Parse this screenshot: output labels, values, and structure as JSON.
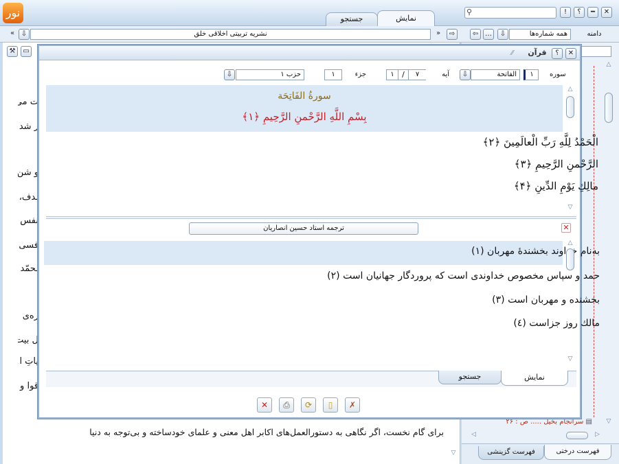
{
  "topbar": {
    "tabs": [
      {
        "label": "نمایش"
      },
      {
        "label": "جستجو"
      }
    ],
    "search_placeholder": "",
    "window_btns": {
      "close": "✕",
      "minimize": "━",
      "help": "؟",
      "alert": "!"
    }
  },
  "address": {
    "domain_label": "دامنه",
    "domain_value": "همه شماره‌ها",
    "publication": "نشریه تربیتی اخلاقی خلق"
  },
  "background_text": {
    "fragments": [
      "ت می",
      "ر شد",
      "و شن",
      "ـدف،",
      "نفس",
      "فسی",
      "ـحمّد",
      "ره‌ی",
      "ل بیت",
      "یاتِ ا",
      "قوا و"
    ],
    "bottom_line": "برای گام نخست، اگر نگاهی به دستورالعمل‌های اکابر اهل معنی و علمای خودساخته و بی‌توجه به دنیا"
  },
  "right_panel": {
    "tree_item": "سرانجام بخیل ..... ص : ۲۶",
    "tabs": [
      {
        "label": "فهرست درختی"
      },
      {
        "label": "فهرست گزینشی"
      }
    ]
  },
  "dialog": {
    "title": "قرآن",
    "help": "؟",
    "close": "✕",
    "labels": {
      "surah": "سوره",
      "ayah": "آیه",
      "juz": "جزء",
      "hizb": "حزب"
    },
    "surah_number": "۱",
    "surah_name": "الفاتحة",
    "ayah_value": "۱",
    "ayah_total": "۷",
    "juz_value": "۱",
    "hizb_value": "حزب ۱",
    "surah_heading": "سورةُ الفَاتِحَة",
    "verses": [
      "بِسْمِ اللَّهِ الرَّحْمنِ الرَّحِیمِ ﴿۱﴾",
      "الْحَمْدُ لِلَّهِ رَبِّ الْعالَمِینَ ﴿۲﴾",
      "الرَّحْمنِ الرَّحِیمِ ﴿۳﴾",
      "مالِكِ یَوْمِ الدِّینِ ﴿۴﴾"
    ],
    "translator": "ترجمه استاد حسین انصاریان",
    "translations": [
      "به‌نام خداوند بخشندهٔ مهربان (۱)",
      "حمد و سپاس مخصوص خداوندی است که پروردگار جهانیان است (۲)",
      "بخشنده و مهربان است (۳)",
      "مالك روز جزاست (٤)"
    ],
    "bottom_tabs": [
      {
        "label": "نمایش"
      },
      {
        "label": "جستجو"
      }
    ],
    "colors": {
      "arabic_red": "#c0202a",
      "heading_gold": "#8a6d1d",
      "highlight": "#dbe8f6"
    }
  }
}
